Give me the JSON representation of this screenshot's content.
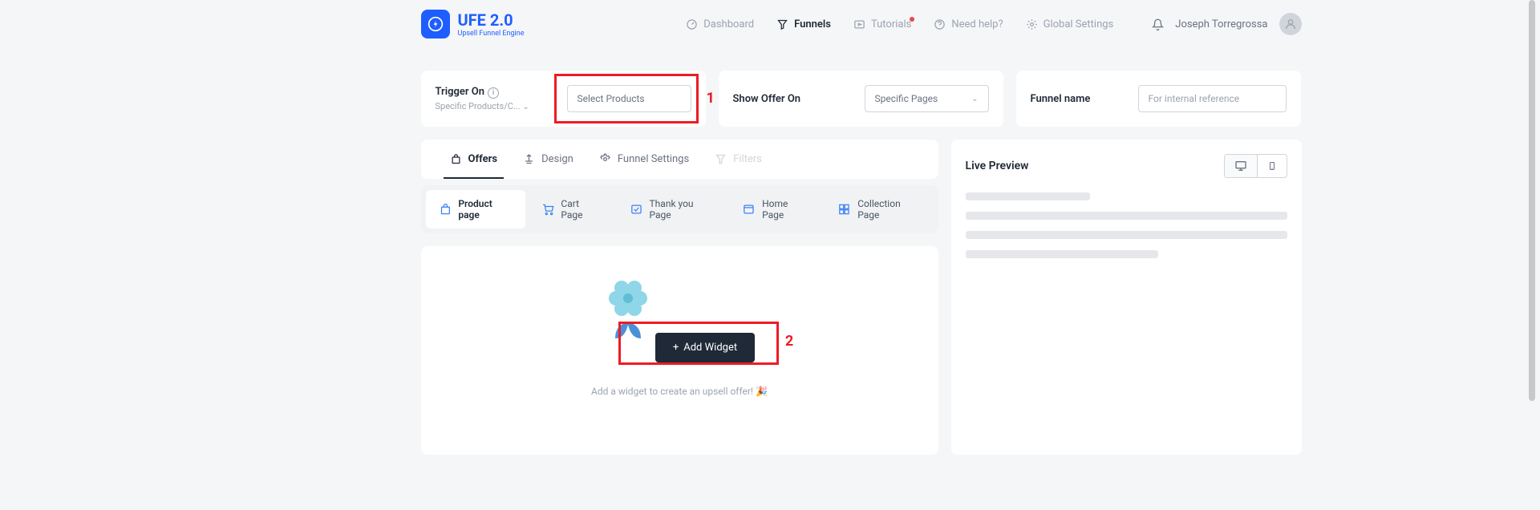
{
  "logo": {
    "name": "UFE 2.0",
    "sub": "Upsell Funnel Engine"
  },
  "nav": {
    "dashboard": "Dashboard",
    "funnels": "Funnels",
    "tutorials": "Tutorials",
    "needhelp": "Need help?",
    "global": "Global Settings"
  },
  "user": {
    "name": "Joseph Torregrossa"
  },
  "trigger": {
    "label": "Trigger On",
    "sub": "Specific Products/C...",
    "button": "Select Products",
    "callout": "1"
  },
  "showOffer": {
    "label": "Show Offer On",
    "value": "Specific Pages"
  },
  "funnelName": {
    "label": "Funnel name",
    "placeholder": "For internal reference"
  },
  "tabs": {
    "offers": "Offers",
    "design": "Design",
    "settings": "Funnel Settings",
    "filters": "Filters"
  },
  "subtabs": {
    "product": "Product page",
    "cart": "Cart Page",
    "thankyou": "Thank you Page",
    "home": "Home Page",
    "collection": "Collection Page"
  },
  "widget": {
    "button": "Add Widget",
    "helper": "Add a widget to create an upsell offer! 🎉",
    "callout": "2"
  },
  "preview": {
    "title": "Live Preview"
  }
}
